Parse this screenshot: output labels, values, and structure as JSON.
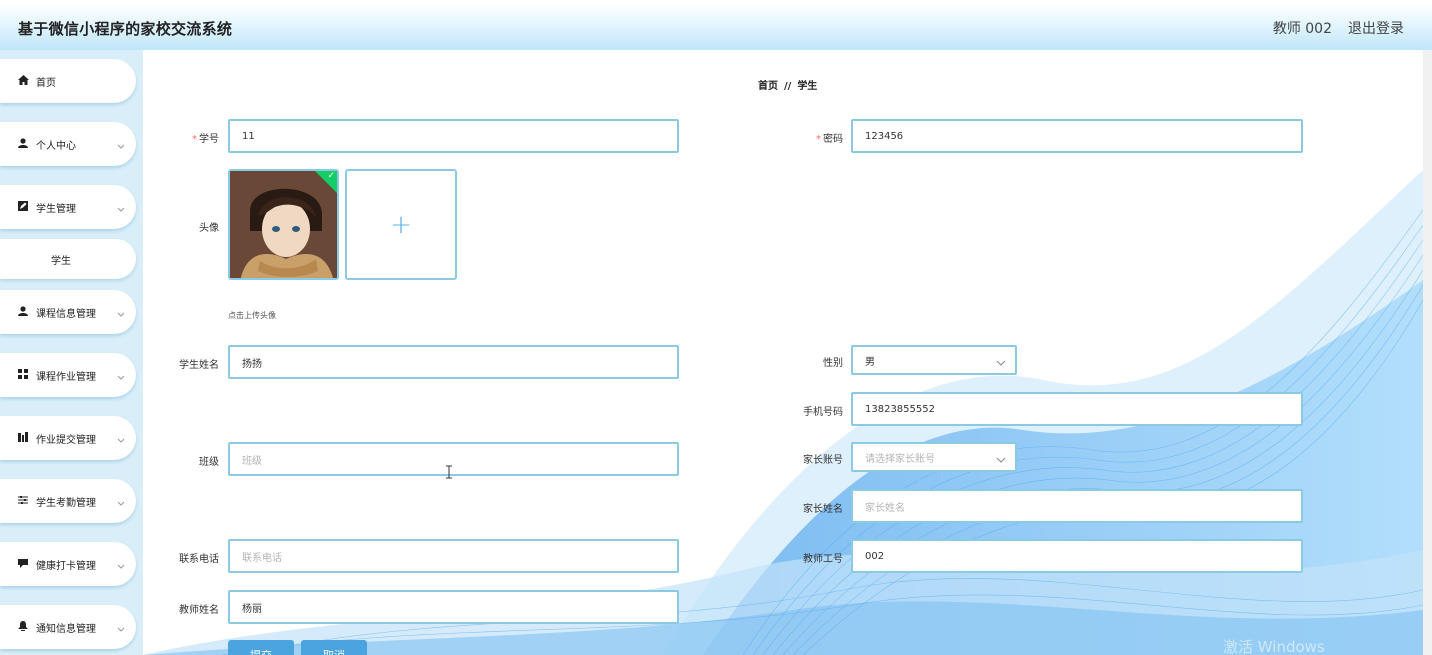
{
  "header": {
    "app_title": "基于微信小程序的家校交流系统",
    "user_label": "教师 002",
    "logout_label": "退出登录"
  },
  "sidebar": {
    "items": [
      {
        "label": "首页",
        "icon": "home-icon"
      },
      {
        "label": "个人中心",
        "icon": "user-icon"
      },
      {
        "label": "学生管理",
        "icon": "edit-icon"
      },
      {
        "label": "学生",
        "sub": true
      },
      {
        "label": "课程信息管理",
        "icon": "user-icon"
      },
      {
        "label": "课程作业管理",
        "icon": "grid-icon"
      },
      {
        "label": "作业提交管理",
        "icon": "chart-icon"
      },
      {
        "label": "学生考勤管理",
        "icon": "sliders-icon"
      },
      {
        "label": "健康打卡管理",
        "icon": "chat-icon"
      },
      {
        "label": "通知信息管理",
        "icon": "bell-icon"
      }
    ]
  },
  "breadcrumb": {
    "home": "首页",
    "separator": "//",
    "current": "学生"
  },
  "form": {
    "student_id": {
      "label": "学号",
      "value": "11"
    },
    "password": {
      "label": "密码",
      "value": "123456"
    },
    "avatar": {
      "label": "头像",
      "hint": "点击上传头像",
      "add_symbol": "+"
    },
    "student_name": {
      "label": "学生姓名",
      "value": "扬扬"
    },
    "gender": {
      "label": "性别",
      "value": "男"
    },
    "phone": {
      "label": "手机号码",
      "value": "13823855552"
    },
    "class": {
      "label": "班级",
      "placeholder": "班级"
    },
    "parent_account": {
      "label": "家长账号",
      "placeholder": "请选择家长账号"
    },
    "parent_name": {
      "label": "家长姓名",
      "placeholder": "家长姓名"
    },
    "contact_phone": {
      "label": "联系电话",
      "placeholder": "联系电话"
    },
    "teacher_id": {
      "label": "教师工号",
      "value": "002"
    },
    "teacher_name": {
      "label": "教师姓名",
      "value": "杨丽"
    }
  },
  "buttons": {
    "submit": "提交",
    "cancel": "取消"
  },
  "watermark": "激活 Windows",
  "colors": {
    "accent": "#4aa4df",
    "field_border": "#8ccae3",
    "required": "#f56c6c",
    "success": "#13ce66"
  }
}
